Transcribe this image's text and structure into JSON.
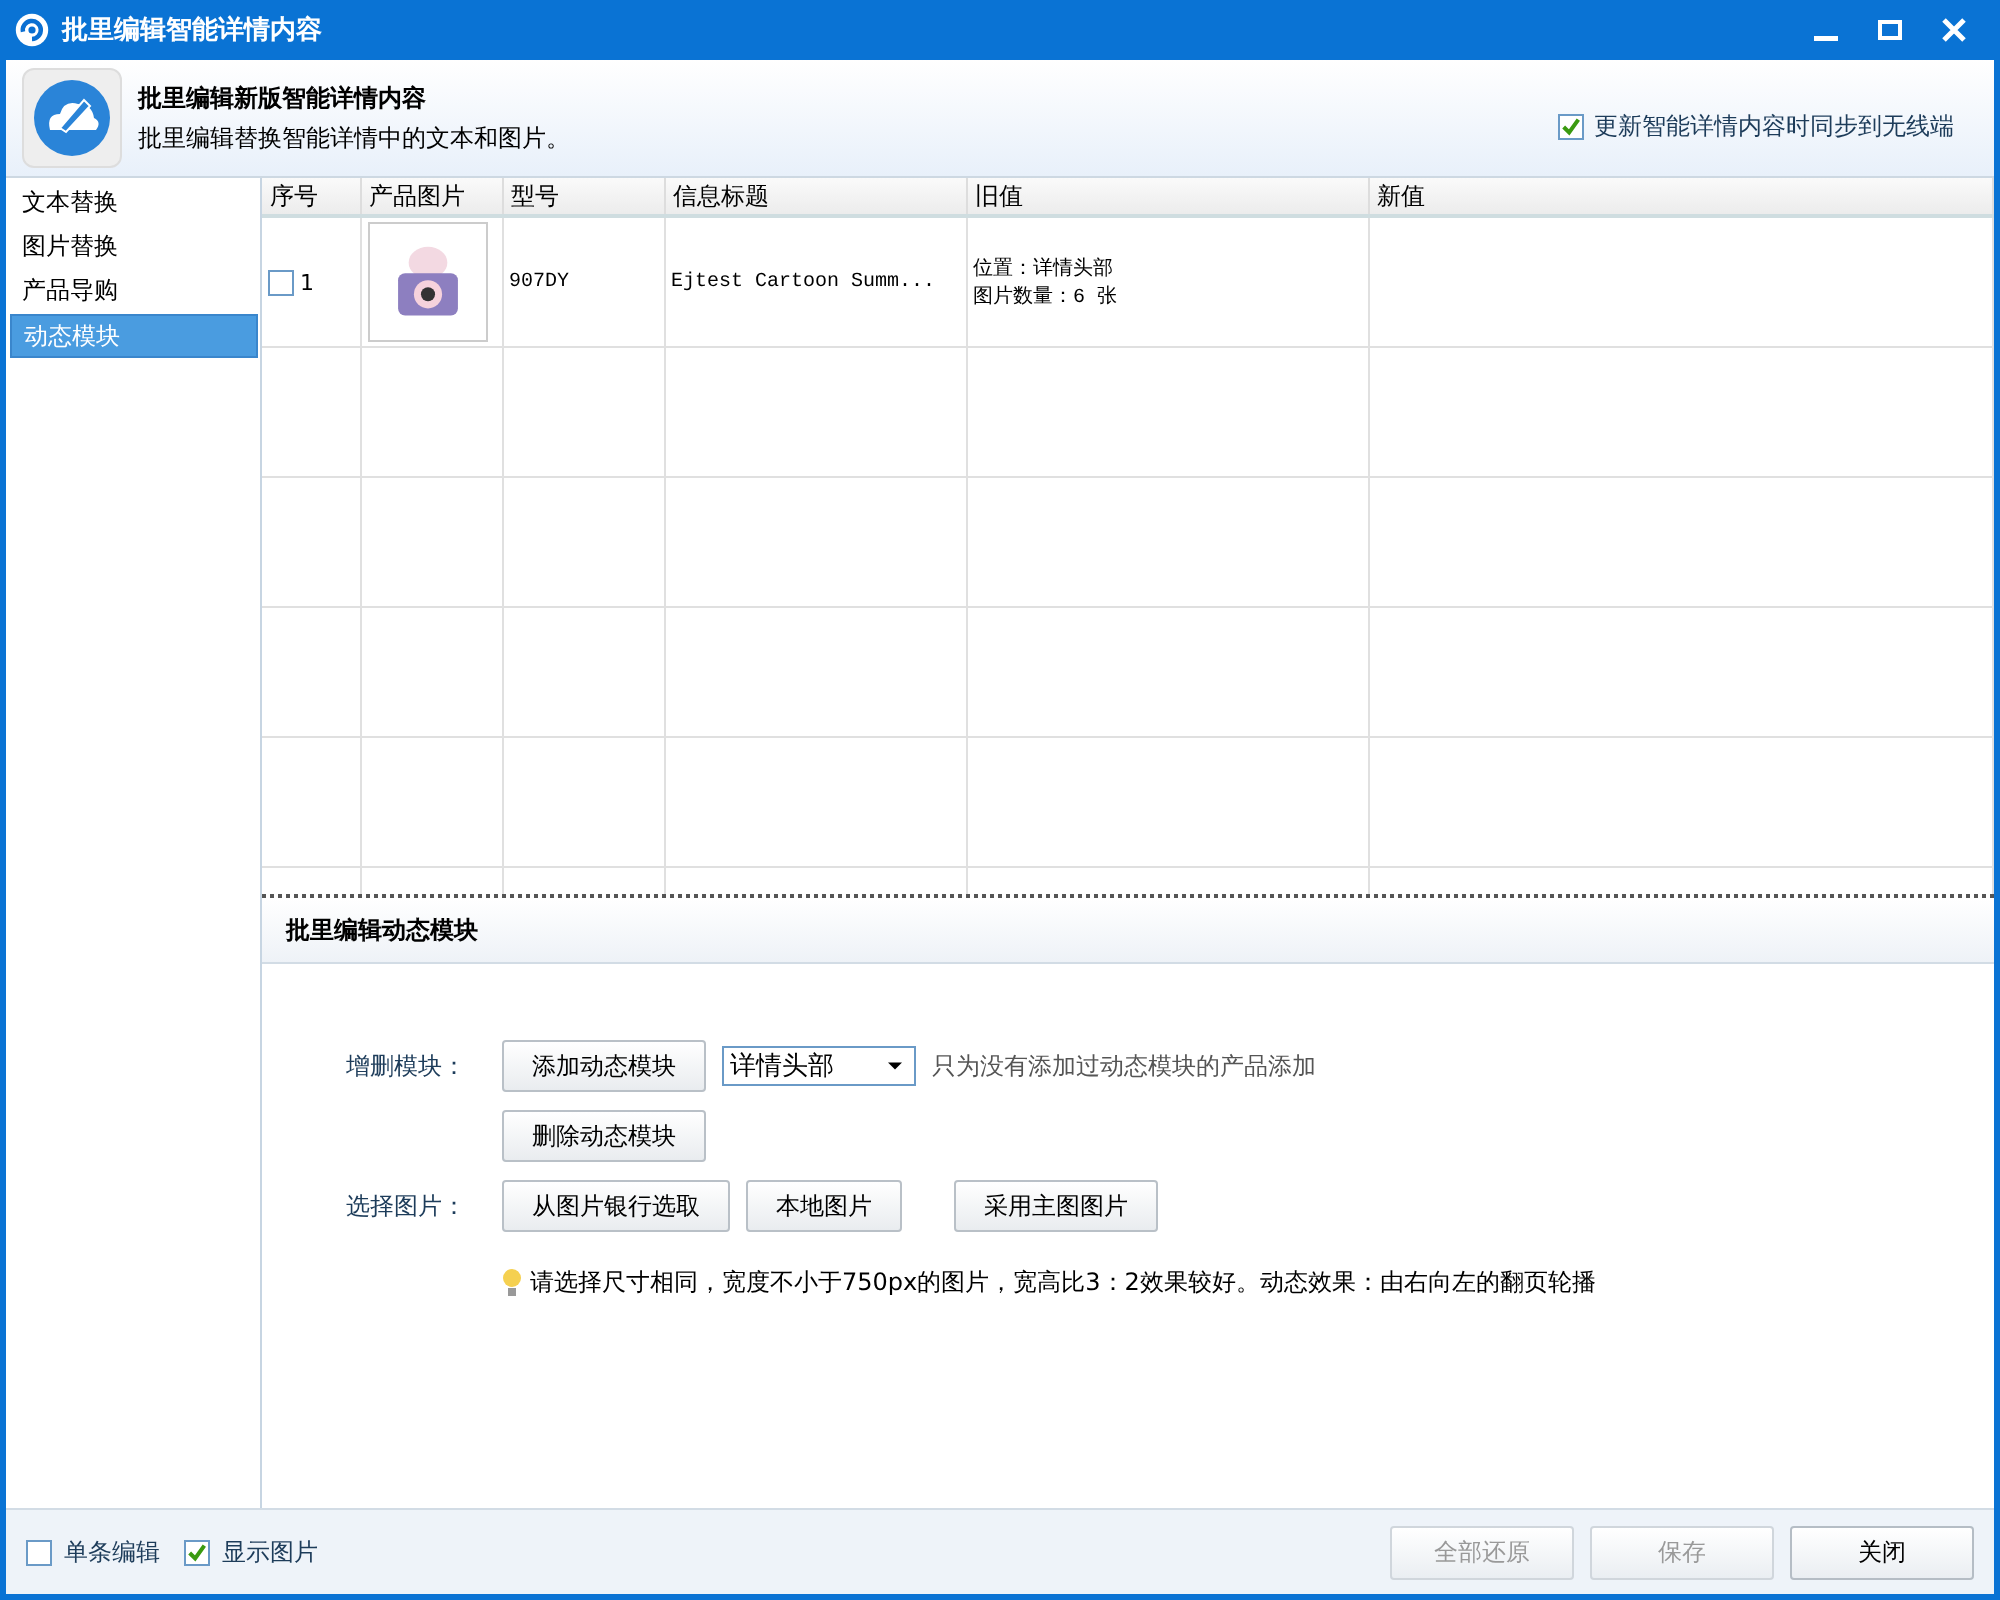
{
  "window": {
    "title": "批里编辑智能详情内容"
  },
  "header": {
    "title": "批里编辑新版智能详情内容",
    "subtitle": "批里编辑替换智能详情中的文本和图片。",
    "sync_option": {
      "label": "更新智能详情内容时同步到无线端",
      "checked": true
    }
  },
  "sidebar": {
    "items": [
      {
        "label": "文本替换",
        "selected": false
      },
      {
        "label": "图片替换",
        "selected": false
      },
      {
        "label": "产品导购",
        "selected": false
      },
      {
        "label": "动态模块",
        "selected": true
      }
    ]
  },
  "table": {
    "columns": [
      "序号",
      "产品图片",
      "型号",
      "信息标题",
      "旧值",
      "新值"
    ],
    "rows": [
      {
        "checked": false,
        "index": "1",
        "model": "907DY",
        "title": "Ejtest Cartoon Summ...",
        "old_value": [
          "位置：详情头部",
          "图片数量：6 张"
        ]
      }
    ]
  },
  "panel": {
    "title": "批里编辑动态模块",
    "module_label": "增删模块：",
    "add_button": "添加动态模块",
    "position_select": "详情头部",
    "add_hint": "只为没有添加过动态模块的产品添加",
    "delete_button": "删除动态模块",
    "image_label": "选择图片：",
    "image_buttons": [
      "从图片银行选取",
      "本地图片",
      "采用主图图片"
    ],
    "tip": "请选择尺寸相同，宽度不小于750px的图片，宽高比3：2效果较好。动态效果：由右向左的翻页轮播"
  },
  "footer": {
    "options": [
      {
        "label": "单条编辑",
        "checked": false
      },
      {
        "label": "显示图片",
        "checked": true
      }
    ],
    "buttons": [
      {
        "label": "全部还原",
        "disabled": true
      },
      {
        "label": "保存",
        "disabled": true
      },
      {
        "label": "关闭",
        "disabled": false
      }
    ]
  }
}
